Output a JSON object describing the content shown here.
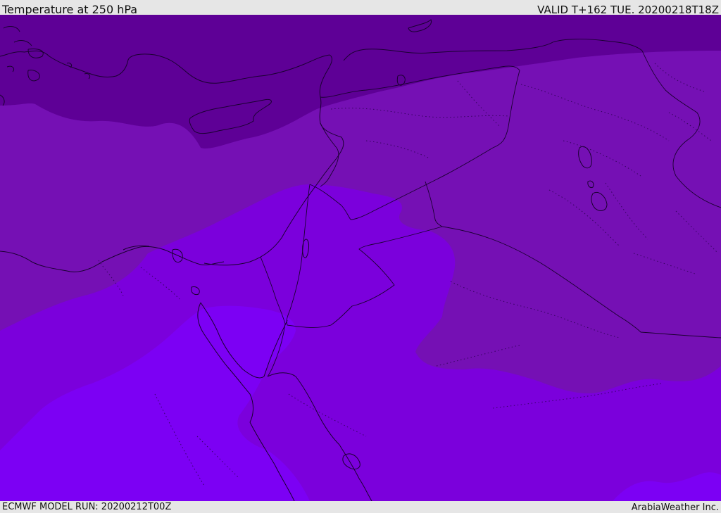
{
  "header": {
    "title": "Temperature at 250 hPa",
    "valid_time": "VALID T+162 TUE. 20200218T18Z"
  },
  "footer": {
    "model_run": "ECMWF MODEL RUN: 20200212T00Z",
    "credit": "ArabiaWeather Inc."
  },
  "colors": {
    "band_coldest": "#5e0096",
    "band_cold": "#6a0aa4",
    "band_mid": "#7510b4",
    "band_warm": "#7b00dc",
    "band_warmest": "#7c00f4",
    "outlines": "#1a0030"
  }
}
